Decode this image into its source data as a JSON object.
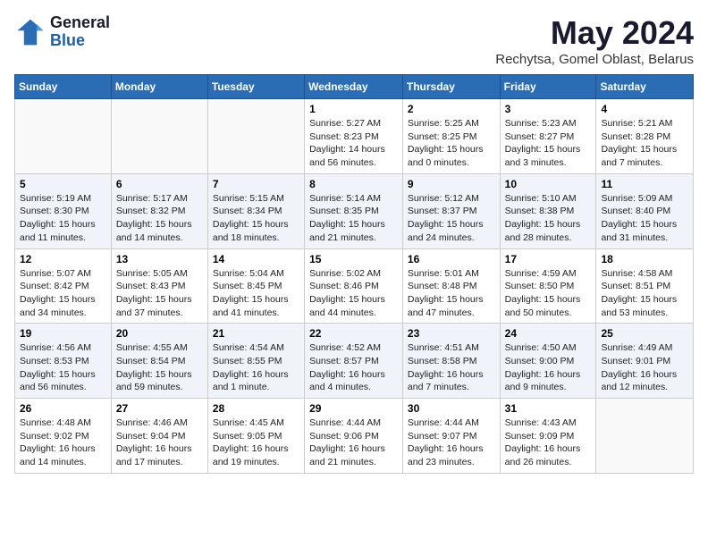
{
  "header": {
    "logo": {
      "line1": "General",
      "line2": "Blue"
    },
    "title": "May 2024",
    "location": "Rechytsa, Gomel Oblast, Belarus"
  },
  "weekdays": [
    "Sunday",
    "Monday",
    "Tuesday",
    "Wednesday",
    "Thursday",
    "Friday",
    "Saturday"
  ],
  "weeks": [
    [
      {
        "day": "",
        "info": ""
      },
      {
        "day": "",
        "info": ""
      },
      {
        "day": "",
        "info": ""
      },
      {
        "day": "1",
        "info": "Sunrise: 5:27 AM\nSunset: 8:23 PM\nDaylight: 14 hours\nand 56 minutes."
      },
      {
        "day": "2",
        "info": "Sunrise: 5:25 AM\nSunset: 8:25 PM\nDaylight: 15 hours\nand 0 minutes."
      },
      {
        "day": "3",
        "info": "Sunrise: 5:23 AM\nSunset: 8:27 PM\nDaylight: 15 hours\nand 3 minutes."
      },
      {
        "day": "4",
        "info": "Sunrise: 5:21 AM\nSunset: 8:28 PM\nDaylight: 15 hours\nand 7 minutes."
      }
    ],
    [
      {
        "day": "5",
        "info": "Sunrise: 5:19 AM\nSunset: 8:30 PM\nDaylight: 15 hours\nand 11 minutes."
      },
      {
        "day": "6",
        "info": "Sunrise: 5:17 AM\nSunset: 8:32 PM\nDaylight: 15 hours\nand 14 minutes."
      },
      {
        "day": "7",
        "info": "Sunrise: 5:15 AM\nSunset: 8:34 PM\nDaylight: 15 hours\nand 18 minutes."
      },
      {
        "day": "8",
        "info": "Sunrise: 5:14 AM\nSunset: 8:35 PM\nDaylight: 15 hours\nand 21 minutes."
      },
      {
        "day": "9",
        "info": "Sunrise: 5:12 AM\nSunset: 8:37 PM\nDaylight: 15 hours\nand 24 minutes."
      },
      {
        "day": "10",
        "info": "Sunrise: 5:10 AM\nSunset: 8:38 PM\nDaylight: 15 hours\nand 28 minutes."
      },
      {
        "day": "11",
        "info": "Sunrise: 5:09 AM\nSunset: 8:40 PM\nDaylight: 15 hours\nand 31 minutes."
      }
    ],
    [
      {
        "day": "12",
        "info": "Sunrise: 5:07 AM\nSunset: 8:42 PM\nDaylight: 15 hours\nand 34 minutes."
      },
      {
        "day": "13",
        "info": "Sunrise: 5:05 AM\nSunset: 8:43 PM\nDaylight: 15 hours\nand 37 minutes."
      },
      {
        "day": "14",
        "info": "Sunrise: 5:04 AM\nSunset: 8:45 PM\nDaylight: 15 hours\nand 41 minutes."
      },
      {
        "day": "15",
        "info": "Sunrise: 5:02 AM\nSunset: 8:46 PM\nDaylight: 15 hours\nand 44 minutes."
      },
      {
        "day": "16",
        "info": "Sunrise: 5:01 AM\nSunset: 8:48 PM\nDaylight: 15 hours\nand 47 minutes."
      },
      {
        "day": "17",
        "info": "Sunrise: 4:59 AM\nSunset: 8:50 PM\nDaylight: 15 hours\nand 50 minutes."
      },
      {
        "day": "18",
        "info": "Sunrise: 4:58 AM\nSunset: 8:51 PM\nDaylight: 15 hours\nand 53 minutes."
      }
    ],
    [
      {
        "day": "19",
        "info": "Sunrise: 4:56 AM\nSunset: 8:53 PM\nDaylight: 15 hours\nand 56 minutes."
      },
      {
        "day": "20",
        "info": "Sunrise: 4:55 AM\nSunset: 8:54 PM\nDaylight: 15 hours\nand 59 minutes."
      },
      {
        "day": "21",
        "info": "Sunrise: 4:54 AM\nSunset: 8:55 PM\nDaylight: 16 hours\nand 1 minute."
      },
      {
        "day": "22",
        "info": "Sunrise: 4:52 AM\nSunset: 8:57 PM\nDaylight: 16 hours\nand 4 minutes."
      },
      {
        "day": "23",
        "info": "Sunrise: 4:51 AM\nSunset: 8:58 PM\nDaylight: 16 hours\nand 7 minutes."
      },
      {
        "day": "24",
        "info": "Sunrise: 4:50 AM\nSunset: 9:00 PM\nDaylight: 16 hours\nand 9 minutes."
      },
      {
        "day": "25",
        "info": "Sunrise: 4:49 AM\nSunset: 9:01 PM\nDaylight: 16 hours\nand 12 minutes."
      }
    ],
    [
      {
        "day": "26",
        "info": "Sunrise: 4:48 AM\nSunset: 9:02 PM\nDaylight: 16 hours\nand 14 minutes."
      },
      {
        "day": "27",
        "info": "Sunrise: 4:46 AM\nSunset: 9:04 PM\nDaylight: 16 hours\nand 17 minutes."
      },
      {
        "day": "28",
        "info": "Sunrise: 4:45 AM\nSunset: 9:05 PM\nDaylight: 16 hours\nand 19 minutes."
      },
      {
        "day": "29",
        "info": "Sunrise: 4:44 AM\nSunset: 9:06 PM\nDaylight: 16 hours\nand 21 minutes."
      },
      {
        "day": "30",
        "info": "Sunrise: 4:44 AM\nSunset: 9:07 PM\nDaylight: 16 hours\nand 23 minutes."
      },
      {
        "day": "31",
        "info": "Sunrise: 4:43 AM\nSunset: 9:09 PM\nDaylight: 16 hours\nand 26 minutes."
      },
      {
        "day": "",
        "info": ""
      }
    ]
  ]
}
